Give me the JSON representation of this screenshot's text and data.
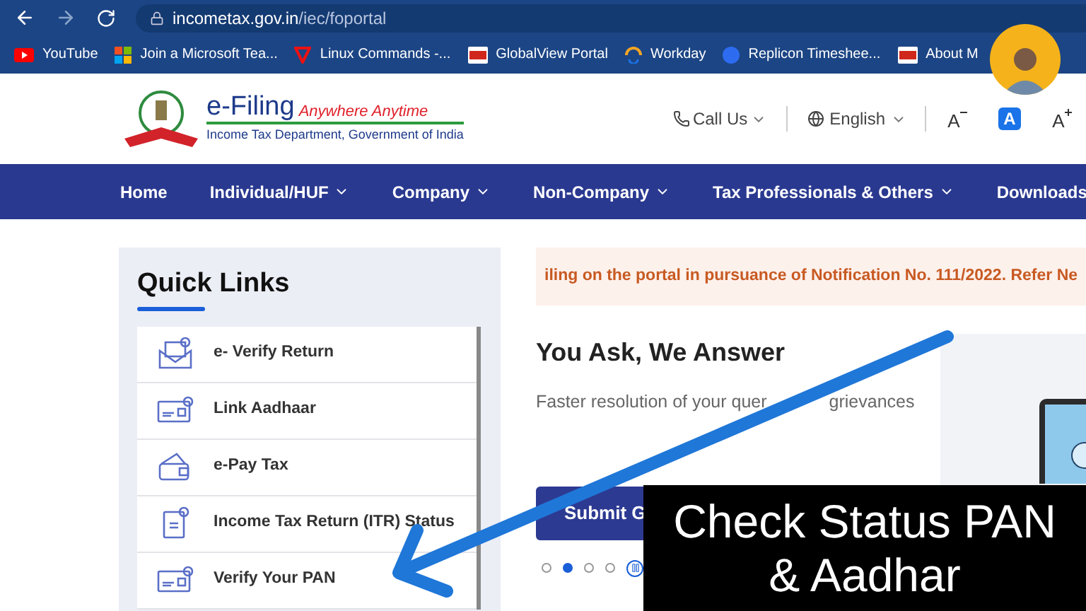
{
  "browser": {
    "url_host": "incometax.gov.in",
    "url_path": "/iec/foportal",
    "bookmarks": [
      {
        "label": "YouTube",
        "kind": "youtube"
      },
      {
        "label": "Join a Microsoft Tea...",
        "kind": "microsoft"
      },
      {
        "label": "Linux Commands -...",
        "kind": "linux"
      },
      {
        "label": "GlobalView Portal",
        "kind": "adp"
      },
      {
        "label": "Workday",
        "kind": "workday"
      },
      {
        "label": "Replicon  Timeshee...",
        "kind": "replicon"
      },
      {
        "label": "About M",
        "kind": "adp"
      }
    ]
  },
  "header": {
    "brand": "e-Filing",
    "tagline": "Anywhere Anytime",
    "subtitle": "Income Tax Department, Government of India",
    "call_us": "Call Us",
    "language": "English",
    "font_buttons": [
      {
        "label": "A",
        "kind": "decrease",
        "selected": false
      },
      {
        "label": "A",
        "kind": "normal",
        "selected": true
      },
      {
        "label": "A",
        "kind": "increase",
        "selected": false
      }
    ]
  },
  "nav": [
    {
      "label": "Home",
      "dropdown": false
    },
    {
      "label": "Individual/HUF",
      "dropdown": true
    },
    {
      "label": "Company",
      "dropdown": true
    },
    {
      "label": "Non-Company",
      "dropdown": true
    },
    {
      "label": "Tax Professionals & Others",
      "dropdown": true
    },
    {
      "label": "Downloads",
      "dropdown": false
    }
  ],
  "quick_links": {
    "title": "Quick Links",
    "items": [
      {
        "label": "e- Verify Return",
        "kind": "envelope"
      },
      {
        "label": "Link Aadhaar",
        "kind": "card"
      },
      {
        "label": "e-Pay Tax",
        "kind": "wallet"
      },
      {
        "label": "Income Tax Return (ITR) Status",
        "kind": "document"
      },
      {
        "label": "Verify Your PAN",
        "kind": "card"
      }
    ]
  },
  "notice": "iling on the portal in pursuance of Notification No. 111/2022. Refer Ne",
  "promo": {
    "title": "You Ask, We Answer",
    "text": [
      "Faster resolution of your quer",
      "grievances"
    ],
    "button": "Submit G",
    "dots": [
      {
        "selected": false
      },
      {
        "selected": true
      },
      {
        "selected": false
      },
      {
        "selected": false
      }
    ]
  },
  "overlay": {
    "lines": [
      "Check Status PAN",
      "& Aadhar"
    ]
  }
}
